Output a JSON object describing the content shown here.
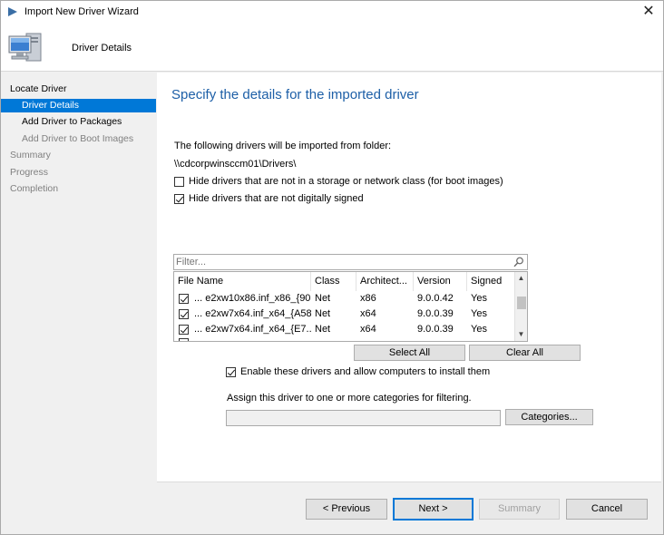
{
  "window": {
    "title": "Import New Driver Wizard",
    "close_glyph": "✕",
    "banner_title": "Driver Details"
  },
  "nav": {
    "items": [
      {
        "label": "Locate Driver",
        "state": "done"
      },
      {
        "label": "Driver Details",
        "state": "active"
      },
      {
        "label": "Add Driver to Packages",
        "state": "done"
      },
      {
        "label": "Add Driver to Boot Images",
        "state": "dim"
      },
      {
        "label": "Summary",
        "state": "dim"
      },
      {
        "label": "Progress",
        "state": "dim"
      },
      {
        "label": "Completion",
        "state": "dim"
      }
    ]
  },
  "page": {
    "heading": "Specify the details for the imported driver",
    "intro": "The following drivers will be imported from folder:",
    "folder": "\\\\cdcorpwinsccm01\\Drivers\\",
    "hide_nonstorage_label": "Hide drivers that are not in a storage or network class (for boot images)",
    "hide_nonstorage_checked": false,
    "hide_unsigned_label": "Hide drivers that are not digitally signed",
    "hide_unsigned_checked": true,
    "filter_placeholder": "Filter...",
    "table": {
      "columns": [
        "File Name",
        "Class",
        "Architect...",
        "Version",
        "Signed"
      ],
      "rows": [
        {
          "checked": true,
          "file": "... e2xw10x86.inf_x86_{90...",
          "class": "Net",
          "arch": "x86",
          "version": "9.0.0.42",
          "signed": "Yes"
        },
        {
          "checked": true,
          "file": "... e2xw7x64.inf_x64_{A58...",
          "class": "Net",
          "arch": "x64",
          "version": "9.0.0.39",
          "signed": "Yes"
        },
        {
          "checked": true,
          "file": "... e2xw7x64.inf_x64_{E7...",
          "class": "Net",
          "arch": "x64",
          "version": "9.0.0.39",
          "signed": "Yes"
        }
      ]
    },
    "select_all": "Select All",
    "clear_all": "Clear All",
    "enable_label": "Enable these drivers and allow computers to install them",
    "enable_checked": true,
    "assign_label": "Assign this driver to one or more categories for filtering.",
    "categories_value": "",
    "categories_button": "Categories..."
  },
  "footer": {
    "previous": "< Previous",
    "next": "Next >",
    "summary": "Summary",
    "cancel": "Cancel"
  },
  "colors": {
    "accent": "#0078d7",
    "heading": "#1d5fa7"
  }
}
